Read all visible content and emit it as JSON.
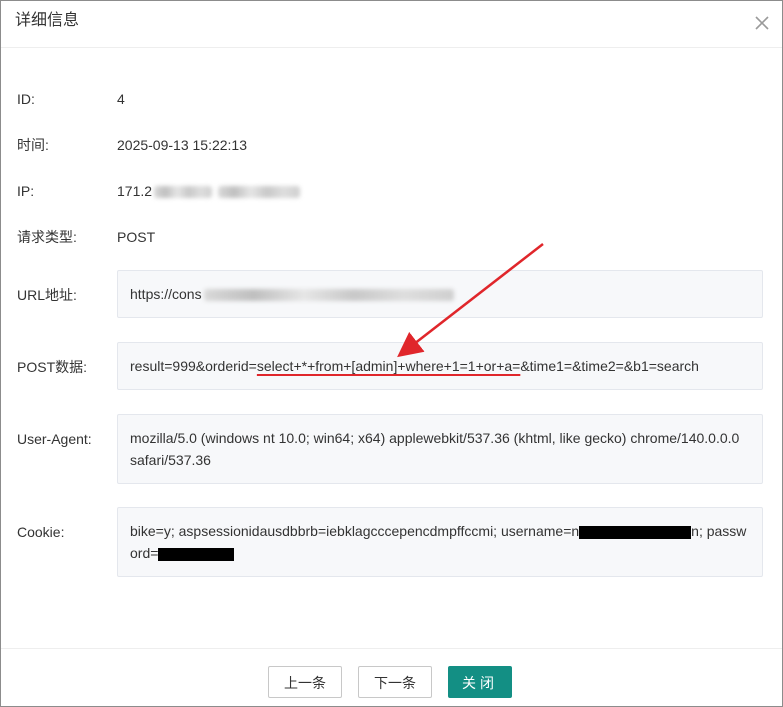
{
  "dialog": {
    "title": "详细信息"
  },
  "fields": {
    "id": {
      "label": "ID:",
      "value": "4"
    },
    "time": {
      "label": "时间:",
      "value": "2025-09-13 15:22:13"
    },
    "ip": {
      "label": "IP:",
      "value": "171.2"
    },
    "method": {
      "label": "请求类型:",
      "value": "POST"
    },
    "url": {
      "label": "URL地址:",
      "value": "https://cons"
    },
    "post": {
      "label": "POST数据:",
      "prefix": "result=999&orderid=",
      "highlight": "select+*+from+[admin]+where+1=1+or+a=",
      "suffix": "&time1=&time2=&b1=search"
    },
    "user_agent": {
      "label": "User-Agent:",
      "value": "mozilla/5.0 (windows nt 10.0; win64; x64) applewebkit/537.36 (khtml, like gecko) chrome/140.0.0.0 safari/537.36"
    },
    "cookie": {
      "label": "Cookie:",
      "part1": "bike=y; aspsessionidausdbbrb=iebklagcccepencdmpffccmi; username=n",
      "part2": "n; passwo",
      "part3": "rd="
    }
  },
  "footer": {
    "prev_label": "上一条",
    "next_label": "下一条",
    "close_label": "关闭"
  },
  "colors": {
    "primary": "#138f84",
    "annotation": "#e0262b"
  }
}
